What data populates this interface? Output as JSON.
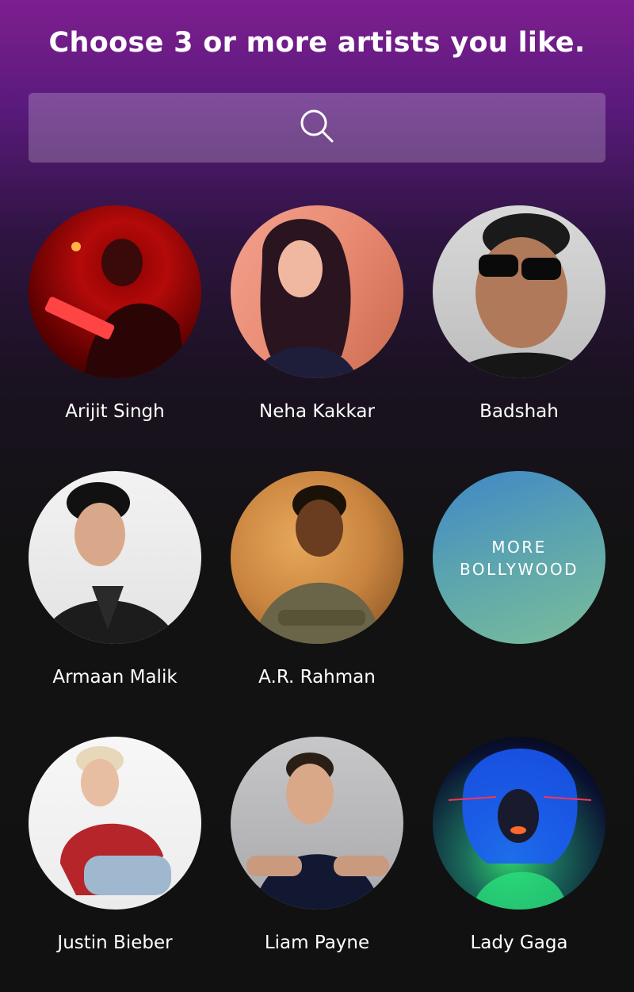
{
  "header": {
    "title": "Choose 3 or more artists you like."
  },
  "search": {
    "icon": "search-icon"
  },
  "artists": [
    {
      "name": "Arijit Singh"
    },
    {
      "name": "Neha Kakkar"
    },
    {
      "name": "Badshah"
    },
    {
      "name": "Armaan Malik"
    },
    {
      "name": "A.R. Rahman"
    },
    {
      "name": "Justin Bieber"
    },
    {
      "name": "Liam Payne"
    },
    {
      "name": "Lady Gaga"
    }
  ],
  "more_tile": {
    "line1": "MORE",
    "line2": "BOLLYWOOD"
  }
}
